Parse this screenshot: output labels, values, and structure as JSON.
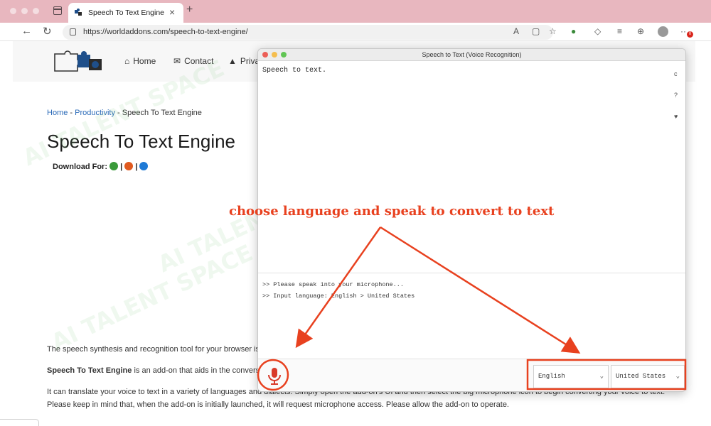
{
  "browser": {
    "tab_title": "Speech To Text Engine - World",
    "url": "https://worldaddons.com/speech-to-text-engine/",
    "notification_count": "0"
  },
  "site": {
    "nav": [
      {
        "label": "Home",
        "icon": "home-icon"
      },
      {
        "label": "Contact",
        "icon": "mail-icon"
      },
      {
        "label": "Priva",
        "icon": "graduation-cap-icon"
      }
    ],
    "breadcrumb": {
      "home": "Home",
      "sep1": " - ",
      "category": "Productivity",
      "sep2": " - ",
      "current": "Speech To Text Engine"
    },
    "title": "Speech To Text Engine",
    "download_label": "Download For:",
    "download_sep": "|",
    "paragraphs": {
      "p1": "The speech synthesis and recognition tool for your browser is s",
      "p2_bold": "Speech To Text Engine",
      "p2_rest": " is an add-on that aids in the conversic",
      "p3": "It can translate your voice to text in a variety of languages and dialects. Simply open the add-on's UI and then select the big microphone icon to begin converting your voice to text.",
      "p4": "Please keep in mind that, when the add-on is initially launched, it will request microphone access. Please allow the add-on to operate."
    }
  },
  "popup": {
    "window_title": "Speech to Text (Voice Recognition)",
    "transcript": "Speech to text.",
    "side_buttons": [
      "c",
      "?",
      "♥"
    ],
    "log": [
      ">> Please speak into your microphone...",
      ">> Input language: English > United States"
    ],
    "language_select": "English",
    "dialect_select": "United States"
  },
  "annotation": {
    "caption": "choose language and speak to convert to text"
  },
  "watermark": "AI TALENT SPACE",
  "colors": {
    "tabbar": "#e8b7bf",
    "accent_annotation": "#e8411f",
    "link": "#2a6ab8"
  }
}
